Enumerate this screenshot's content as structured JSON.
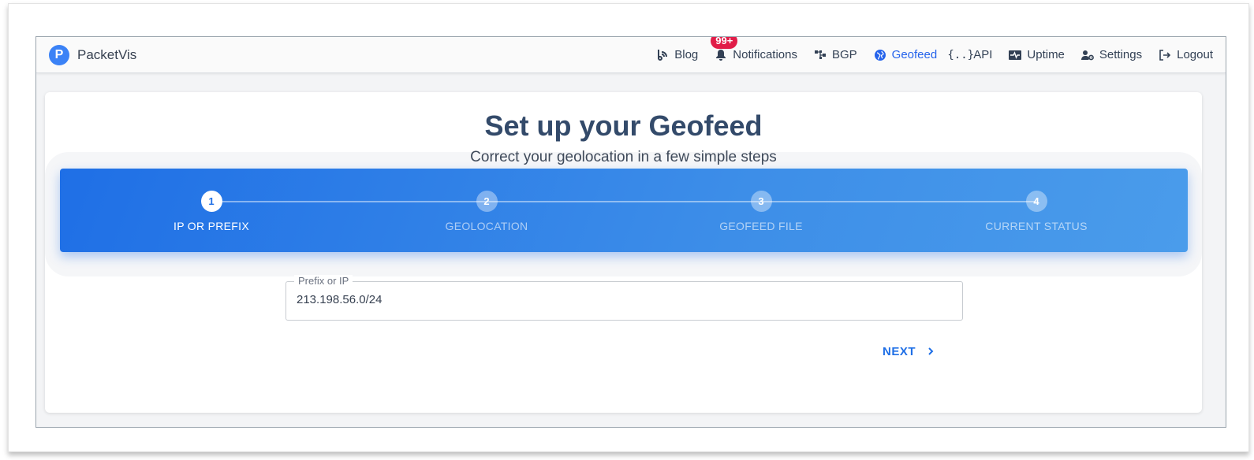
{
  "brand": {
    "logo_letter": "P",
    "name": "PacketVis"
  },
  "nav": {
    "items": [
      {
        "label": "Blog",
        "icon": "blog-icon"
      },
      {
        "label": "Notifications",
        "icon": "bell-icon",
        "badge": "99+"
      },
      {
        "label": "BGP",
        "icon": "sitemap-icon"
      },
      {
        "label": "Geofeed",
        "icon": "globe-icon",
        "active": true
      },
      {
        "label": "API",
        "icon": "braces-icon"
      },
      {
        "label": "Uptime",
        "icon": "heartbeat-icon"
      },
      {
        "label": "Settings",
        "icon": "user-gear-icon"
      },
      {
        "label": "Logout",
        "icon": "logout-icon"
      }
    ]
  },
  "page": {
    "title": "Set up your Geofeed",
    "subtitle": "Correct your geolocation in a few simple steps"
  },
  "stepper": {
    "steps": [
      {
        "number": "1",
        "label": "IP OR PREFIX",
        "state": "current"
      },
      {
        "number": "2",
        "label": "GEOLOCATION",
        "state": "pending"
      },
      {
        "number": "3",
        "label": "GEOFEED FILE",
        "state": "pending"
      },
      {
        "number": "4",
        "label": "CURRENT STATUS",
        "state": "pending"
      }
    ]
  },
  "form": {
    "prefix_label": "Prefix or IP",
    "prefix_value": "213.198.56.0/24",
    "next_label": "NEXT"
  },
  "colors": {
    "accent": "#1f6fe6",
    "badge": "#e11d48",
    "title": "#334a6a"
  }
}
